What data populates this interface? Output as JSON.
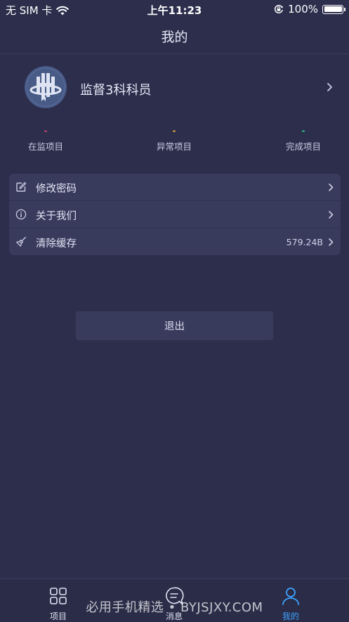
{
  "status_bar": {
    "carrier": "无 SIM 卡",
    "time": "上午11:23",
    "battery": "100%"
  },
  "header": {
    "title": "我的"
  },
  "profile": {
    "name": "监督3科科员"
  },
  "stats": [
    {
      "value": "-",
      "label": "在监项目",
      "color": "#e23d7a"
    },
    {
      "value": "-",
      "label": "异常项目",
      "color": "#f0b23a"
    },
    {
      "value": "-",
      "label": "完成项目",
      "color": "#2fcf8f"
    }
  ],
  "settings": {
    "change_password": {
      "label": "修改密码",
      "icon": "edit-icon"
    },
    "about_us": {
      "label": "关于我们",
      "icon": "info-icon"
    },
    "clear_cache": {
      "label": "清除缓存",
      "icon": "broom-icon",
      "value": "579.24B"
    }
  },
  "logout": {
    "label": "退出"
  },
  "tabs": [
    {
      "label": "项目",
      "icon": "grid-icon",
      "active": false
    },
    {
      "label": "消息",
      "icon": "message-icon",
      "active": false
    },
    {
      "label": "我的",
      "icon": "user-icon",
      "active": true
    }
  ],
  "watermark": "必用手机精选 • BYJSJXY.COM",
  "colors": {
    "background": "#2d2e4c",
    "card": "#393b5d",
    "accent": "#3da3ff"
  }
}
